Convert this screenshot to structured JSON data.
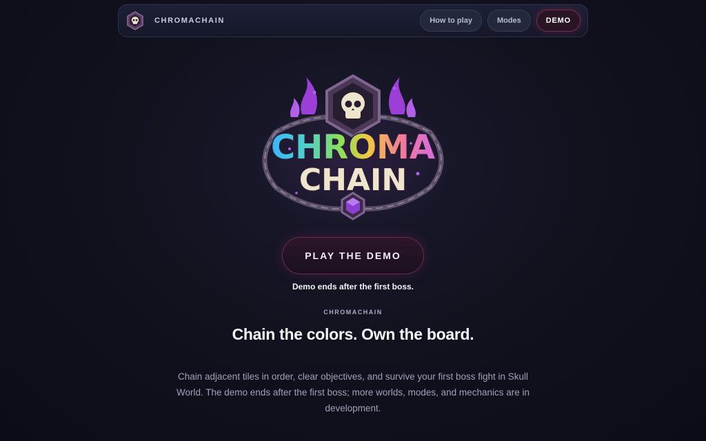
{
  "nav": {
    "brand": "CHROMACHAIN",
    "links": [
      "How to play",
      "Modes"
    ],
    "demo_label": "DEMO"
  },
  "hero": {
    "logo_line1": "CHROMA",
    "logo_line2": "CHAIN",
    "play_button": "PLAY THE DEMO",
    "demo_note": "Demo ends after the first boss.",
    "eyebrow": "CHROMACHAIN",
    "headline": "Chain the colors. Own the board.",
    "description": "Chain adjacent tiles in order, clear objectives, and survive your first boss fight in Skull World. The demo ends after the first boss; more worlds, modes, and mechanics are in development."
  },
  "colors": {
    "background": "#12121f",
    "accent": "#7a2c52",
    "purple_flame": "#9b3fd6",
    "bone": "#efe4cc"
  },
  "icons": [
    "skull-hex-logo-icon",
    "purple-gem-icon",
    "chain-frame-icon",
    "flame-icon"
  ]
}
